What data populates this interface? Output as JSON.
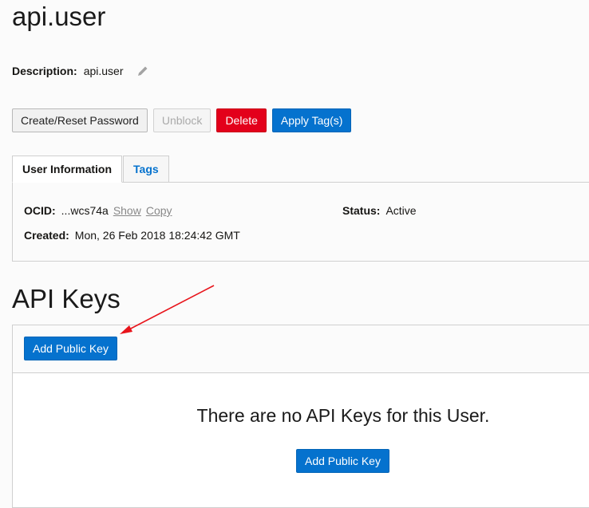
{
  "page": {
    "title": "api.user"
  },
  "description": {
    "label": "Description:",
    "value": "api.user",
    "edit_icon": "pencil-icon"
  },
  "actions": {
    "reset_password": "Create/Reset Password",
    "unblock": "Unblock",
    "delete": "Delete",
    "apply_tags": "Apply Tag(s)"
  },
  "tabs": [
    {
      "label": "User Information",
      "active": true
    },
    {
      "label": "Tags",
      "active": false
    }
  ],
  "user_info": {
    "ocid_label": "OCID:",
    "ocid_value": "...wcs74a",
    "show_link": "Show",
    "copy_link": "Copy",
    "status_label": "Status:",
    "status_value": "Active",
    "created_label": "Created:",
    "created_value": "Mon, 26 Feb 2018 18:24:42 GMT"
  },
  "api_keys": {
    "title": "API Keys",
    "add_button": "Add Public Key",
    "empty_message": "There are no API Keys for this User.",
    "empty_add_button": "Add Public Key"
  },
  "colors": {
    "primary": "#0572ce",
    "danger": "#e3001b",
    "annotation_arrow": "#e8141b"
  }
}
